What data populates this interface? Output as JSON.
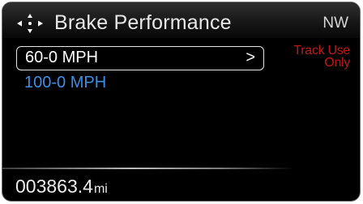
{
  "header": {
    "title": "Brake Performance",
    "compass": "NW",
    "nav_icon": "four-way-arrows-icon"
  },
  "menu": {
    "items": [
      {
        "label": "60-0 MPH",
        "selected": true,
        "chevron": ">"
      },
      {
        "label": "100-0 MPH",
        "selected": false
      }
    ]
  },
  "warning": {
    "line1": "Track Use",
    "line2": "Only"
  },
  "odometer": {
    "value": "003863.4",
    "unit": "mi"
  },
  "colors": {
    "background": "#000000",
    "text": "#e8e8e8",
    "accent_blue": "#3d8ee6",
    "warning_red": "#c41515"
  }
}
